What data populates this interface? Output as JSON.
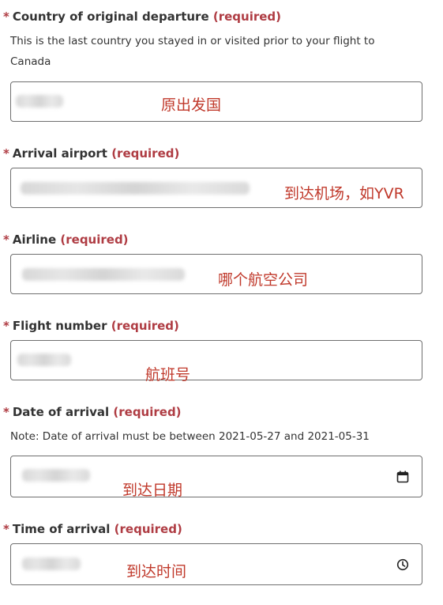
{
  "fields": {
    "country": {
      "star": "*",
      "label": "Country of original departure",
      "required": "(required)",
      "help": "This is the last country you stayed in or visited prior to your flight to Canada",
      "note": "原出发国"
    },
    "airport": {
      "star": "*",
      "label": "Arrival airport",
      "required": "(required)",
      "note": "到达机场，如YVR"
    },
    "airline": {
      "star": "*",
      "label": "Airline",
      "required": "(required)",
      "note": "哪个航空公司"
    },
    "flight": {
      "star": "*",
      "label": "Flight number",
      "required": "(required)",
      "note": "航班号"
    },
    "date": {
      "star": "*",
      "label": "Date of arrival",
      "required": "(required)",
      "help": "Note: Date of arrival must be between 2021-05-27 and 2021-05-31",
      "note": "到达日期",
      "icon": "calendar-icon"
    },
    "time": {
      "star": "*",
      "label": "Time of arrival",
      "required": "(required)",
      "note": "到达时间",
      "icon": "clock-icon"
    }
  },
  "colors": {
    "required": "#af3c43",
    "annotation": "#c0392b",
    "border": "#6f6f6f"
  }
}
